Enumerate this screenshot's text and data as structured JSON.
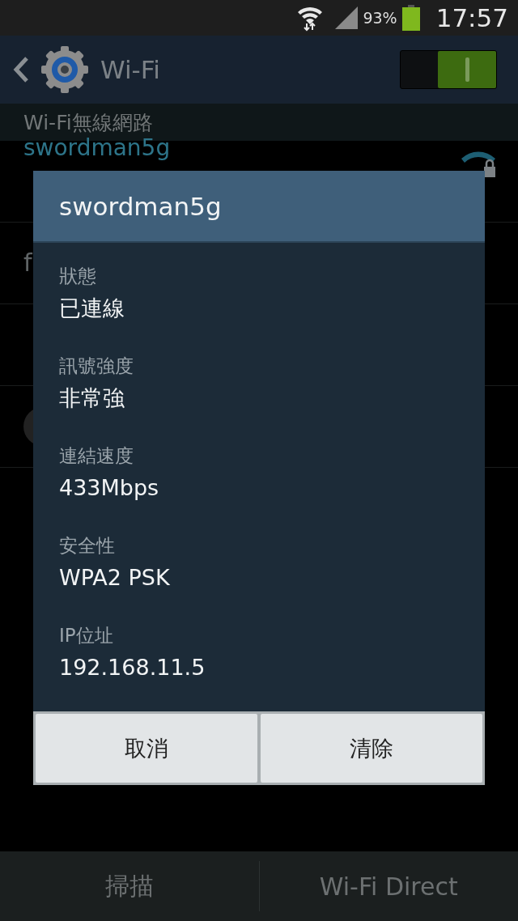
{
  "status_bar": {
    "battery": "93%",
    "time": "17:57"
  },
  "action_bar": {
    "title": "Wi-Fi",
    "switch_on": true
  },
  "section_header": "Wi-Fi無線網路",
  "networks": [
    {
      "name": "swordman5g",
      "locked": true
    },
    {
      "name": "f",
      "locked": false
    }
  ],
  "dialog": {
    "title": "swordman5g",
    "fields": [
      {
        "label": "狀態",
        "value": "已連線"
      },
      {
        "label": "訊號強度",
        "value": "非常強"
      },
      {
        "label": "連結速度",
        "value": "433Mbps"
      },
      {
        "label": "安全性",
        "value": "WPA2 PSK"
      },
      {
        "label": "IP位址",
        "value": "192.168.11.5"
      }
    ],
    "buttons": [
      "取消",
      "清除"
    ]
  },
  "bottom_bar": [
    "掃描",
    "Wi-Fi Direct"
  ]
}
